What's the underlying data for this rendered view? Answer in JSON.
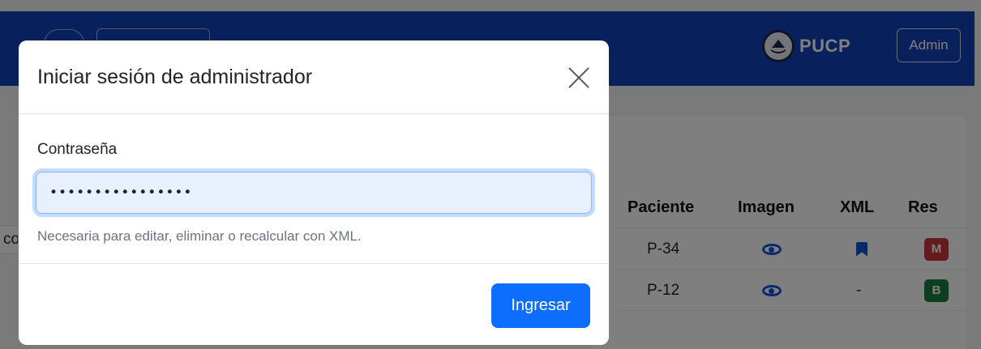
{
  "navbar": {
    "brand_name": "PUCP",
    "admin_label": "Admin"
  },
  "table": {
    "partial_cell_text": "co",
    "headers": {
      "patient": "Paciente",
      "image": "Imagen",
      "xml": "XML",
      "result": "Res"
    },
    "rows": [
      {
        "patient": "P-34",
        "image_icon": "eye-icon",
        "xml": "bookmark-icon",
        "result_badge": "M",
        "result_color": "#c9343f"
      },
      {
        "patient": "P-12",
        "image_icon": "eye-icon",
        "xml": "-",
        "result_badge": "B",
        "result_color": "#1e7a45"
      }
    ]
  },
  "modal": {
    "title": "Iniciar sesión de administrador",
    "password_label": "Contraseña",
    "password_value": "••••••••••••••••",
    "help_text": "Necesaria para editar, eliminar o recalcular con XML.",
    "submit_label": "Ingresar"
  },
  "colors": {
    "navbar": "#1040b8",
    "primary": "#0d6efd"
  }
}
